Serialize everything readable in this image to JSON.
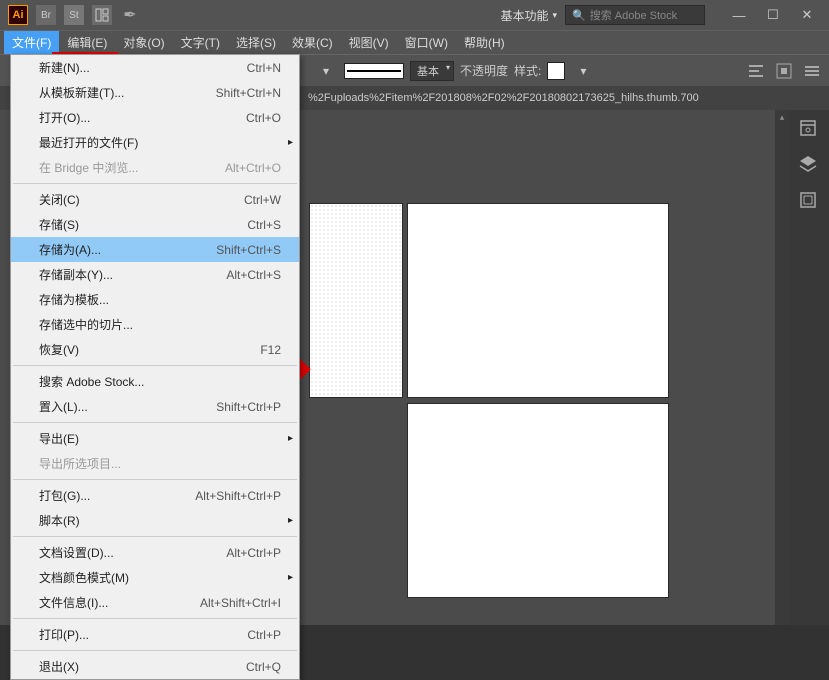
{
  "titlebar": {
    "logo": "Ai",
    "workspace": "基本功能",
    "search_placeholder": "搜索 Adobe Stock"
  },
  "menubar": {
    "items": [
      {
        "label": "文件(F)"
      },
      {
        "label": "编辑(E)"
      },
      {
        "label": "对象(O)"
      },
      {
        "label": "文字(T)"
      },
      {
        "label": "选择(S)"
      },
      {
        "label": "效果(C)"
      },
      {
        "label": "视图(V)"
      },
      {
        "label": "窗口(W)"
      },
      {
        "label": "帮助(H)"
      }
    ]
  },
  "toolbar": {
    "stroke_style": "基本",
    "opacity": "不透明度",
    "style": "样式:"
  },
  "doc_tab": "%2Fuploads%2Fitem%2F201808%2F02%2F20180802173625_hilhs.thumb.700",
  "dropdown": {
    "items": [
      {
        "label": "新建(N)...",
        "shortcut": "Ctrl+N",
        "sep": false
      },
      {
        "label": "从模板新建(T)...",
        "shortcut": "Shift+Ctrl+N",
        "sep": false
      },
      {
        "label": "打开(O)...",
        "shortcut": "Ctrl+O",
        "sep": false
      },
      {
        "label": "最近打开的文件(F)",
        "shortcut": "",
        "sep": false,
        "submenu": true
      },
      {
        "label": "在 Bridge 中浏览...",
        "shortcut": "Alt+Ctrl+O",
        "sep": false,
        "disabled": true
      },
      {
        "sep": true
      },
      {
        "label": "关闭(C)",
        "shortcut": "Ctrl+W",
        "sep": false
      },
      {
        "label": "存储(S)",
        "shortcut": "Ctrl+S",
        "sep": false
      },
      {
        "label": "存储为(A)...",
        "shortcut": "Shift+Ctrl+S",
        "sep": false,
        "highlighted": true
      },
      {
        "label": "存储副本(Y)...",
        "shortcut": "Alt+Ctrl+S",
        "sep": false
      },
      {
        "label": "存储为模板...",
        "shortcut": "",
        "sep": false
      },
      {
        "label": "存储选中的切片...",
        "shortcut": "",
        "sep": false
      },
      {
        "label": "恢复(V)",
        "shortcut": "F12",
        "sep": false
      },
      {
        "sep": true
      },
      {
        "label": "搜索 Adobe Stock...",
        "shortcut": "",
        "sep": false
      },
      {
        "label": "置入(L)...",
        "shortcut": "Shift+Ctrl+P",
        "sep": false
      },
      {
        "sep": true
      },
      {
        "label": "导出(E)",
        "shortcut": "",
        "sep": false,
        "submenu": true
      },
      {
        "label": "导出所选项目...",
        "shortcut": "",
        "sep": false,
        "disabled": true
      },
      {
        "sep": true
      },
      {
        "label": "打包(G)...",
        "shortcut": "Alt+Shift+Ctrl+P",
        "sep": false
      },
      {
        "label": "脚本(R)",
        "shortcut": "",
        "sep": false,
        "submenu": true
      },
      {
        "sep": true
      },
      {
        "label": "文档设置(D)...",
        "shortcut": "Alt+Ctrl+P",
        "sep": false
      },
      {
        "label": "文档颜色模式(M)",
        "shortcut": "",
        "sep": false,
        "submenu": true
      },
      {
        "label": "文件信息(I)...",
        "shortcut": "Alt+Shift+Ctrl+I",
        "sep": false
      },
      {
        "sep": true
      },
      {
        "label": "打印(P)...",
        "shortcut": "Ctrl+P",
        "sep": false
      },
      {
        "sep": true
      },
      {
        "label": "退出(X)",
        "shortcut": "Ctrl+Q",
        "sep": false
      }
    ]
  }
}
